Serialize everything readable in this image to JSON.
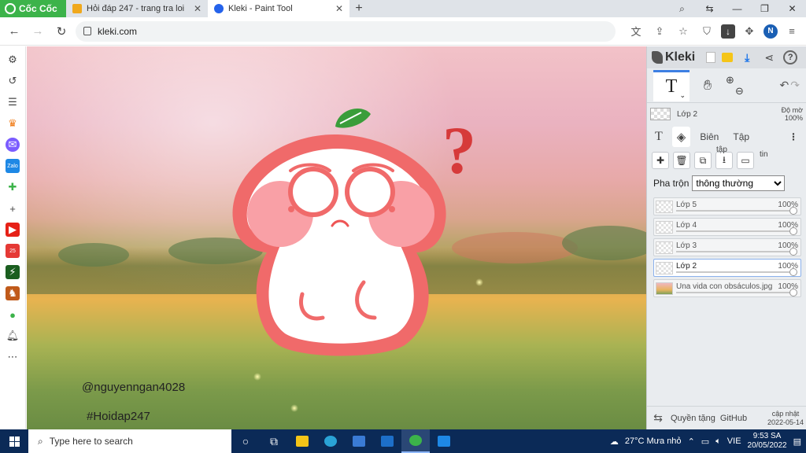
{
  "browser": {
    "brand": "Cốc Cốc",
    "tabs": [
      {
        "title": "Hỏi đáp 247 - trang tra loi",
        "active": false,
        "favicon_color": "#f0a81c"
      },
      {
        "title": "Kleki - Paint Tool",
        "active": true,
        "favicon_color": "#2563eb"
      }
    ],
    "url": "kleki.com",
    "profile_initial": "N"
  },
  "sidebar_icons": [
    "settings-icon",
    "history-icon",
    "list-icon",
    "crown-icon",
    "messenger-icon",
    "zalo-icon",
    "game-icon",
    "add-icon",
    "youtube-icon",
    "calendar-icon",
    "bolt-icon",
    "app-icon",
    "coccoc-icon",
    "notification-icon",
    "more-icon"
  ],
  "canvas": {
    "watermark_1": "@nguyenngan4028",
    "watermark_2": "#Hoidap247",
    "question_mark": "?"
  },
  "kleki": {
    "brand": "Kleki",
    "current_tool": "T",
    "current_layer": "Lớp 2",
    "opacity_label": "Độ mờ",
    "opacity_value": "100%",
    "tabs": {
      "text": "T",
      "edit": "Biên",
      "file": "Tập"
    },
    "actions_sup": "tập",
    "actions_tail": "tin",
    "blend_label": "Pha trộn",
    "blend_value": "thông thường",
    "layers": [
      {
        "name": "Lớp 5",
        "opacity": "100%",
        "active": false,
        "image": false
      },
      {
        "name": "Lớp 4",
        "opacity": "100%",
        "active": false,
        "image": false
      },
      {
        "name": "Lớp 3",
        "opacity": "100%",
        "active": false,
        "image": false
      },
      {
        "name": "Lớp 2",
        "opacity": "100%",
        "active": true,
        "image": false
      },
      {
        "name": "Una vida con obsáculos.jpg",
        "opacity": "100%",
        "active": false,
        "image": true
      }
    ],
    "footer": {
      "privacy": "Quyền tặng",
      "github": "GitHub",
      "updated_label": "cập nhật",
      "updated_date": "2022-05-14"
    }
  },
  "taskbar": {
    "search_placeholder": "Type here to search",
    "weather": "27°C  Mưa nhỏ",
    "lang": "VIE",
    "time": "9:53 SA",
    "date": "20/05/2022"
  },
  "colors": {
    "brand_green": "#3cb34a",
    "accent_blue": "#3d7fe3",
    "character_red": "#f06a6a",
    "taskbar": "#0b2a57"
  }
}
